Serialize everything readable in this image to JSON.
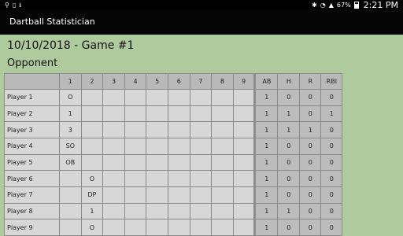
{
  "status": {
    "battery": "67%",
    "time": "2:21 PM"
  },
  "app": {
    "title": "Dartball Statistician"
  },
  "game": {
    "title": "10/10/2018 - Game #1",
    "team": "Opponent"
  },
  "columns": [
    "",
    "1",
    "2",
    "3",
    "4",
    "5",
    "6",
    "7",
    "8",
    "9",
    "AB",
    "H",
    "R",
    "RBI"
  ],
  "rows": [
    {
      "name": "Player 1",
      "innings": [
        "O",
        "",
        "",
        "",
        "",
        "",
        "",
        "",
        ""
      ],
      "ab": "1",
      "h": "0",
      "r": "0",
      "rbi": "0"
    },
    {
      "name": "Player 2",
      "innings": [
        "1",
        "",
        "",
        "",
        "",
        "",
        "",
        "",
        ""
      ],
      "ab": "1",
      "h": "1",
      "r": "0",
      "rbi": "1"
    },
    {
      "name": "Player 3",
      "innings": [
        "3",
        "",
        "",
        "",
        "",
        "",
        "",
        "",
        ""
      ],
      "ab": "1",
      "h": "1",
      "r": "1",
      "rbi": "0"
    },
    {
      "name": "Player 4",
      "innings": [
        "SO",
        "",
        "",
        "",
        "",
        "",
        "",
        "",
        ""
      ],
      "ab": "1",
      "h": "0",
      "r": "0",
      "rbi": "0"
    },
    {
      "name": "Player 5",
      "innings": [
        "OB",
        "",
        "",
        "",
        "",
        "",
        "",
        "",
        ""
      ],
      "ab": "1",
      "h": "0",
      "r": "0",
      "rbi": "0"
    },
    {
      "name": "Player 6",
      "innings": [
        "",
        "O",
        "",
        "",
        "",
        "",
        "",
        "",
        ""
      ],
      "ab": "1",
      "h": "0",
      "r": "0",
      "rbi": "0"
    },
    {
      "name": "Player 7",
      "innings": [
        "",
        "DP",
        "",
        "",
        "",
        "",
        "",
        "",
        ""
      ],
      "ab": "1",
      "h": "0",
      "r": "0",
      "rbi": "0"
    },
    {
      "name": "Player 8",
      "innings": [
        "",
        "1",
        "",
        "",
        "",
        "",
        "",
        "",
        ""
      ],
      "ab": "1",
      "h": "1",
      "r": "0",
      "rbi": "0"
    },
    {
      "name": "Player 9",
      "innings": [
        "",
        "O",
        "",
        "",
        "",
        "",
        "",
        "",
        ""
      ],
      "ab": "1",
      "h": "0",
      "r": "0",
      "rbi": "0"
    }
  ],
  "icons": {
    "status_left": [
      "usb-icon",
      "sd-card-icon",
      "download-icon"
    ],
    "status_right": [
      "bluetooth-icon",
      "wifi-icon",
      "signal-icon",
      "battery-icon"
    ]
  },
  "colors": {
    "background": "#afcb9d",
    "appbar": "#050505",
    "cell": "#d7d7d7",
    "header": "#b9b9b9"
  }
}
